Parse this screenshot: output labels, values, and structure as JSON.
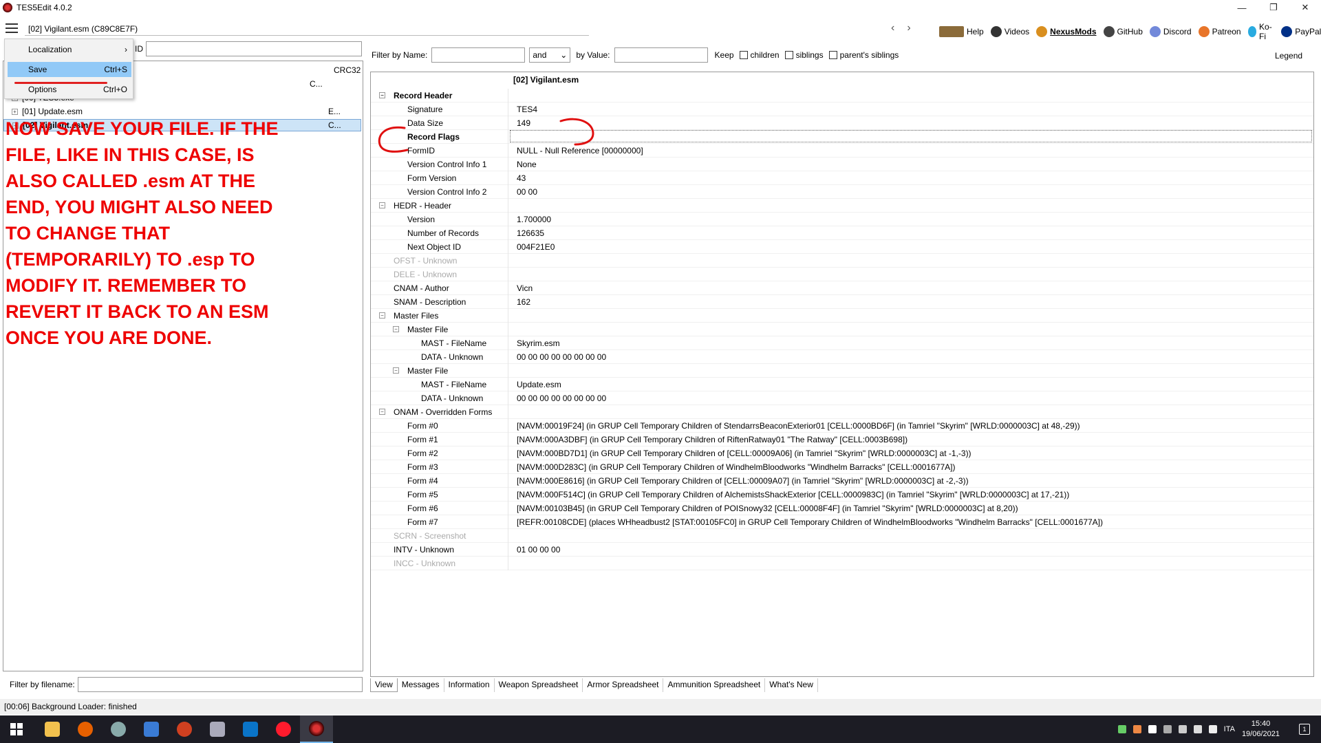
{
  "window": {
    "title": "TES5Edit 4.0.2",
    "minimize": "—",
    "maximize": "❐",
    "close": "✕"
  },
  "toolbar": {
    "path": "[02] Vigilant.esm (C89C8E7F)",
    "back": "‹",
    "forward": "›",
    "links": [
      "Help",
      "Videos",
      "NexusMods",
      "GitHub",
      "Discord",
      "Patreon",
      "Ko-Fi",
      "PayPal"
    ]
  },
  "menu": {
    "items": [
      {
        "label": "Localization",
        "shortcut": "›"
      },
      {
        "label": "Save",
        "shortcut": "Ctrl+S"
      },
      {
        "label": "Options",
        "shortcut": "Ctrl+O"
      }
    ]
  },
  "left": {
    "id_label": "ID",
    "crc_header": "CRC32",
    "rows": [
      {
        "name": "",
        "crc": "C..."
      },
      {
        "name": "[00] TES5.exe",
        "crc": ""
      },
      {
        "name": "[01] Update.esm",
        "crc": "E..."
      },
      {
        "name": "[02] Vigilant.esm",
        "crc": "C..."
      }
    ],
    "filter_label": "Filter by filename:"
  },
  "annotation": {
    "lines": [
      "NOW SAVE YOUR FILE. IF THE",
      "FILE, LIKE IN THIS CASE, IS",
      "ALSO CALLED   .esm  AT THE",
      "END, YOU MIGHT ALSO NEED",
      "TO CHANGE THAT",
      "(TEMPORARILY) TO  .esp  TO",
      "MODIFY IT. REMEMBER TO",
      "REVERT IT BACK TO AN ESM",
      "ONCE YOU ARE DONE."
    ],
    "color": "#e00000"
  },
  "filter": {
    "by_name": "Filter by Name:",
    "and": "and",
    "by_value": "by Value:",
    "keep": "Keep",
    "children": "children",
    "siblings": "siblings",
    "parents_siblings": "parent's siblings",
    "legend": "Legend"
  },
  "records": {
    "column_header": "[02] Vigilant.esm",
    "rows": [
      {
        "label": "Record Header",
        "value": ""
      },
      {
        "label": "Signature",
        "value": "TES4"
      },
      {
        "label": "Data Size",
        "value": "149"
      },
      {
        "label": "Record Flags",
        "value": ""
      },
      {
        "label": "FormID",
        "value": "NULL - Null Reference [00000000]"
      },
      {
        "label": "Version Control Info 1",
        "value": "None"
      },
      {
        "label": "Form Version",
        "value": "43"
      },
      {
        "label": "Version Control Info 2",
        "value": "00 00"
      },
      {
        "label": "HEDR - Header",
        "value": ""
      },
      {
        "label": "Version",
        "value": "1.700000"
      },
      {
        "label": "Number of Records",
        "value": "126635"
      },
      {
        "label": "Next Object ID",
        "value": "004F21E0"
      },
      {
        "label": "OFST - Unknown",
        "value": ""
      },
      {
        "label": "DELE - Unknown",
        "value": ""
      },
      {
        "label": "CNAM - Author",
        "value": "Vicn"
      },
      {
        "label": "SNAM - Description",
        "value": "162"
      },
      {
        "label": "Master Files",
        "value": ""
      },
      {
        "label": "Master File",
        "value": ""
      },
      {
        "label": "MAST - FileName",
        "value": "Skyrim.esm"
      },
      {
        "label": "DATA - Unknown",
        "value": "00 00 00 00 00 00 00 00"
      },
      {
        "label": "Master File",
        "value": ""
      },
      {
        "label": "MAST - FileName",
        "value": "Update.esm"
      },
      {
        "label": "DATA - Unknown",
        "value": "00 00 00 00 00 00 00 00"
      },
      {
        "label": "ONAM - Overridden Forms",
        "value": ""
      },
      {
        "label": "Form #0",
        "value": "[NAVM:00019F24] (in GRUP Cell Temporary Children of StendarrsBeaconExterior01 [CELL:0000BD6F] (in Tamriel \"Skyrim\" [WRLD:0000003C] at 48,-29))"
      },
      {
        "label": "Form #1",
        "value": "[NAVM:000A3DBF] (in GRUP Cell Temporary Children of RiftenRatway01 \"The Ratway\" [CELL:0003B698])"
      },
      {
        "label": "Form #2",
        "value": "[NAVM:000BD7D1] (in GRUP Cell Temporary Children of [CELL:00009A06] (in Tamriel \"Skyrim\" [WRLD:0000003C] at -1,-3))"
      },
      {
        "label": "Form #3",
        "value": "[NAVM:000D283C] (in GRUP Cell Temporary Children of WindhelmBloodworks \"Windhelm Barracks\" [CELL:0001677A])"
      },
      {
        "label": "Form #4",
        "value": "[NAVM:000E8616] (in GRUP Cell Temporary Children of [CELL:00009A07] (in Tamriel \"Skyrim\" [WRLD:0000003C] at -2,-3))"
      },
      {
        "label": "Form #5",
        "value": "[NAVM:000F514C] (in GRUP Cell Temporary Children of AlchemistsShackExterior [CELL:0000983C] (in Tamriel \"Skyrim\" [WRLD:0000003C] at 17,-21))"
      },
      {
        "label": "Form #6",
        "value": "[NAVM:00103B45] (in GRUP Cell Temporary Children of POISnowy32 [CELL:00008F4F] (in Tamriel \"Skyrim\" [WRLD:0000003C] at 8,20))"
      },
      {
        "label": "Form #7",
        "value": "[REFR:00108CDE] (places WHheadbust2 [STAT:00105FC0] in GRUP Cell Temporary Children of WindhelmBloodworks \"Windhelm Barracks\" [CELL:0001677A])"
      },
      {
        "label": "SCRN - Screenshot",
        "value": ""
      },
      {
        "label": "INTV - Unknown",
        "value": "01 00 00 00"
      },
      {
        "label": "INCC - Unknown",
        "value": ""
      }
    ]
  },
  "tabs": [
    "View",
    "Messages",
    "Information",
    "Weapon Spreadsheet",
    "Armor Spreadsheet",
    "Ammunition Spreadsheet",
    "What's New"
  ],
  "status": "[00:06] Background Loader: finished",
  "taskbar": {
    "lang": "ITA",
    "time": "15:40",
    "date": "19/06/2021",
    "notif_count": "1"
  }
}
